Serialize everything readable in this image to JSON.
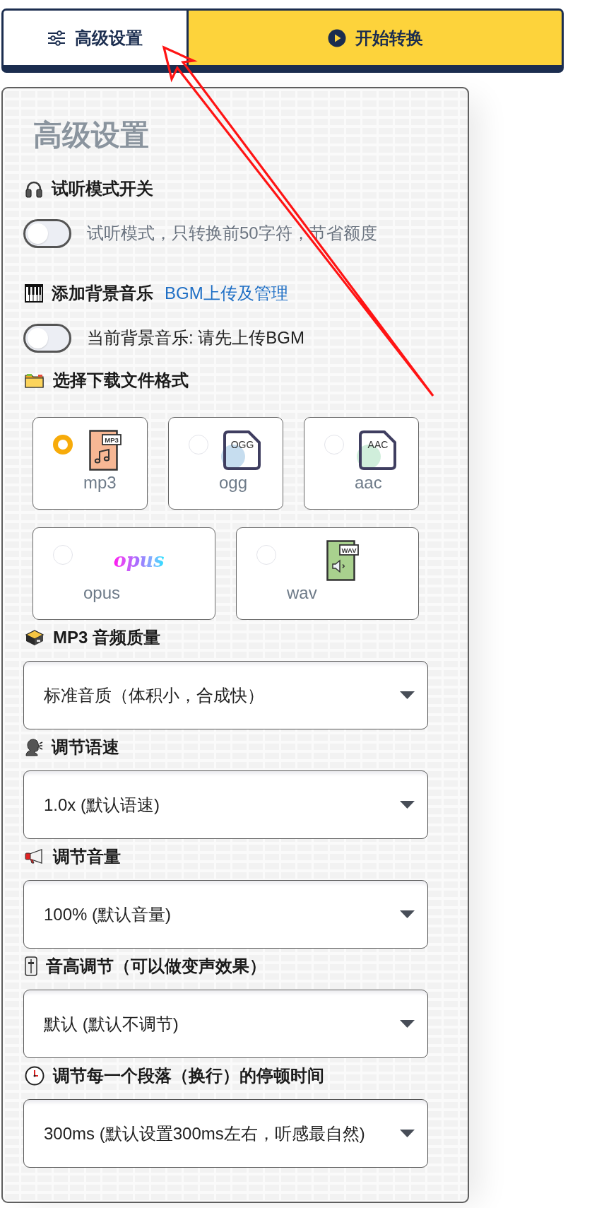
{
  "toolbar": {
    "buttons": [
      {
        "kind": "settings",
        "label": "高级设置"
      },
      {
        "kind": "primary",
        "label": "开始转换"
      }
    ]
  },
  "panel": {
    "title": "高级设置",
    "sections": [
      {
        "kind": "toggle",
        "heading": "试听模式开关",
        "switch": {
          "on": false
        },
        "description": "试听模式，只转换前50字符，节省额度",
        "dimmed": true
      },
      {
        "kind": "toggle",
        "heading": "添加背景音乐",
        "link": "BGM上传及管理",
        "switch": {
          "on": false
        },
        "description": "当前背景音乐: 请先上传BGM",
        "dimmed": false
      },
      {
        "kind": "formats",
        "heading": "选择下载文件格式",
        "formats": [
          {
            "label": "mp3",
            "kind": "music-file",
            "badge": "MP3",
            "selected": true
          },
          {
            "label": "ogg",
            "kind": "document",
            "badge": "OGG",
            "color": "#c6ddef",
            "selected": false
          },
          {
            "label": "aac",
            "kind": "document",
            "badge": "AAC",
            "color": "#d0eedb",
            "selected": false
          },
          {
            "label": "opus",
            "kind": "logo",
            "badge": "opus",
            "selected": false
          },
          {
            "label": "wav",
            "kind": "audio-file",
            "badge": "WAV",
            "selected": false
          }
        ]
      },
      {
        "kind": "select",
        "heading": "MP3 音频质量",
        "value": "标准音质（体积小，合成快）"
      },
      {
        "kind": "select",
        "heading": "调节语速",
        "value": "1.0x (默认语速)"
      },
      {
        "kind": "select",
        "heading": "调节音量",
        "value": "100% (默认音量)"
      },
      {
        "kind": "select",
        "heading": "音高调节（可以做变声效果）",
        "value": "默认 (默认不调节)"
      },
      {
        "kind": "select",
        "heading": "调节每一个段落（换行）的停顿时间",
        "value": "300ms (默认设置300ms左右，听感最自然)"
      }
    ]
  }
}
